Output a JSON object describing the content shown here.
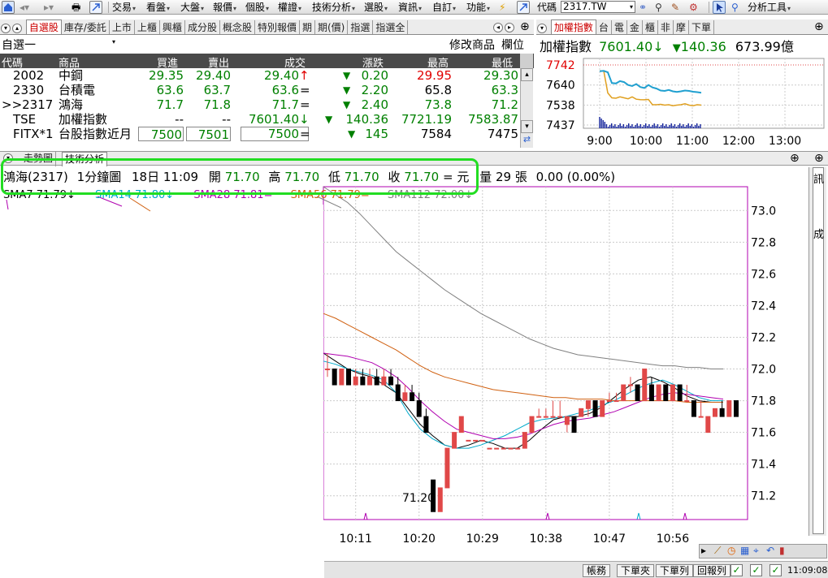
{
  "toolbar": {
    "menus": [
      "交易",
      "看盤",
      "大盤",
      "報價",
      "個股",
      "權證",
      "技術分析",
      "選股",
      "資訊",
      "自訂",
      "功能"
    ],
    "code_label": "代碼",
    "code_value": "2317.TW",
    "analysis_tool": "分析工具"
  },
  "left_tabs": [
    "自選股",
    "庫存/委託",
    "上市",
    "上櫃",
    "興櫃",
    "成分股",
    "概念股",
    "特別報價",
    "期",
    "期(價)",
    "指選",
    "指選全"
  ],
  "right_tabs": [
    "加權指數",
    "台",
    "電",
    "金",
    "櫃",
    "非",
    "摩",
    "下單"
  ],
  "watchlist": {
    "name": "自選一",
    "edit_label": "修改商品",
    "field_label": "欄位"
  },
  "quote_table": {
    "headers": [
      "代碼",
      "商品",
      "買進",
      "賣出",
      "成交",
      "漲跌",
      "最高",
      "最低"
    ],
    "rows": [
      {
        "code": "2002",
        "name": "中鋼",
        "bid": "29.35",
        "ask": "29.40",
        "last": "29.40",
        "last_mark": "↑",
        "chg_mark": "▼",
        "chg": "0.20",
        "high": "29.95",
        "low": "29.30"
      },
      {
        "code": "2330",
        "name": "台積電",
        "bid": "63.6",
        "ask": "63.7",
        "last": "63.6",
        "last_mark": "=",
        "chg_mark": "▼",
        "chg": "2.20",
        "high": "65.8",
        "low": "63.3"
      },
      {
        "code": ">>2317",
        "name": "鴻海",
        "bid": "71.7",
        "ask": "71.8",
        "last": "71.7",
        "last_mark": "=",
        "chg_mark": "▼",
        "chg": "2.40",
        "high": "73.8",
        "low": "71.2"
      },
      {
        "code": "TSE",
        "name": "加權指數",
        "bid": "--",
        "ask": "--",
        "last": "7601.40",
        "last_mark": "↓",
        "chg_mark": "▼",
        "chg": "140.36",
        "high": "7721.19",
        "low": "7583.87"
      },
      {
        "code": "FITX*1",
        "name": "台股指數近月",
        "bid": "7500",
        "ask": "7501",
        "last": "7500",
        "last_mark": "=",
        "chg_mark": "▼",
        "chg": "145",
        "high": "7584",
        "low": "7475"
      }
    ]
  },
  "index_panel": {
    "name": "加權指數",
    "value": "7601.40",
    "arrow": "↓",
    "chg_mark": "▼",
    "change": "140.36",
    "volume": "673.99億",
    "y_ticks": [
      "7742",
      "7640",
      "7538",
      "7437"
    ],
    "x_ticks": [
      "9:00",
      "10:00",
      "11:00",
      "12:00",
      "13:00"
    ]
  },
  "chart_tabs": [
    "走勢圖",
    "技術分析"
  ],
  "info": {
    "stock": "鴻海(2317)",
    "period": "1分鐘圖",
    "date": "18日",
    "time": "11:09",
    "open_label": "開",
    "open": "71.70",
    "high_label": "高",
    "high": "71.70",
    "low_label": "低",
    "low": "71.70",
    "close_label": "收",
    "close": "71.70",
    "eq": "= 元",
    "vol_label": "量",
    "volume": "29",
    "vol_unit": "張",
    "change": "0.00 (0.00%)"
  },
  "ma_line": {
    "sma7": "SMA7 71.79↓",
    "sma14": "SMA14 71.80↓",
    "sma28": "SMA28 71.81=",
    "sma56": "SMA56 71.79=",
    "sma112": "SMA112 72.00↓"
  },
  "chart_data": {
    "type": "candlestick",
    "y_ticks": [
      "73.0",
      "72.8",
      "72.6",
      "72.4",
      "72.2",
      "72.0",
      "71.8",
      "71.6",
      "71.4",
      "71.2"
    ],
    "x_ticks": [
      "10:11",
      "10:20",
      "10:29",
      "10:38",
      "10:47",
      "10:56"
    ],
    "low_annotation": "71.20",
    "candles": [
      [
        72.0,
        72.1,
        71.95,
        72.0
      ],
      [
        72.0,
        72.0,
        71.9,
        71.9
      ],
      [
        71.9,
        72.0,
        71.9,
        72.0
      ],
      [
        72.0,
        72.0,
        71.9,
        71.9
      ],
      [
        71.9,
        72.0,
        71.9,
        71.95
      ],
      [
        71.95,
        72.0,
        71.9,
        71.9
      ],
      [
        71.9,
        72.0,
        71.9,
        71.95
      ],
      [
        71.95,
        72.0,
        71.9,
        71.9
      ],
      [
        71.9,
        72.0,
        71.9,
        71.95
      ],
      [
        71.95,
        72.0,
        71.9,
        71.9
      ],
      [
        71.9,
        71.95,
        71.8,
        71.8
      ],
      [
        71.8,
        71.9,
        71.8,
        71.85
      ],
      [
        71.85,
        71.9,
        71.8,
        71.8
      ],
      [
        71.8,
        71.85,
        71.7,
        71.7
      ],
      [
        71.7,
        71.75,
        71.6,
        71.6
      ],
      [
        71.3,
        71.3,
        71.1,
        71.1
      ],
      [
        71.1,
        71.25,
        71.1,
        71.25
      ],
      [
        71.25,
        71.5,
        71.25,
        71.5
      ],
      [
        71.5,
        71.6,
        71.5,
        71.6
      ],
      [
        71.6,
        71.7,
        71.6,
        71.7
      ],
      [
        71.55,
        71.55,
        71.55,
        71.55
      ],
      [
        71.55,
        71.55,
        71.55,
        71.55
      ],
      [
        71.55,
        71.55,
        71.55,
        71.55
      ],
      [
        71.5,
        71.5,
        71.5,
        71.5
      ],
      [
        71.5,
        71.5,
        71.5,
        71.5
      ],
      [
        71.5,
        71.5,
        71.5,
        71.5
      ],
      [
        71.5,
        71.5,
        71.5,
        71.5
      ],
      [
        71.5,
        71.5,
        71.5,
        71.5
      ],
      [
        71.5,
        71.6,
        71.5,
        71.6
      ],
      [
        71.6,
        71.7,
        71.6,
        71.7
      ],
      [
        71.7,
        71.75,
        71.7,
        71.7
      ],
      [
        71.7,
        71.75,
        71.7,
        71.7
      ],
      [
        71.7,
        71.8,
        71.7,
        71.7
      ],
      [
        71.7,
        71.8,
        71.7,
        71.7
      ],
      [
        71.65,
        71.7,
        71.6,
        71.7
      ],
      [
        71.7,
        71.7,
        71.6,
        71.6
      ],
      [
        71.7,
        71.75,
        71.7,
        71.75
      ],
      [
        71.75,
        71.8,
        71.7,
        71.8
      ],
      [
        71.8,
        71.8,
        71.7,
        71.7
      ],
      [
        71.7,
        71.8,
        71.7,
        71.8
      ],
      [
        71.8,
        71.85,
        71.8,
        71.8
      ],
      [
        71.8,
        71.85,
        71.8,
        71.8
      ],
      [
        71.8,
        71.9,
        71.8,
        71.9
      ],
      [
        71.9,
        71.95,
        71.85,
        71.9
      ],
      [
        71.9,
        71.9,
        71.8,
        71.8
      ],
      [
        71.8,
        72.0,
        71.8,
        72.0
      ],
      [
        71.9,
        71.95,
        71.8,
        71.8
      ],
      [
        71.8,
        71.9,
        71.8,
        71.9
      ],
      [
        71.9,
        71.9,
        71.8,
        71.8
      ],
      [
        71.8,
        71.9,
        71.8,
        71.9
      ],
      [
        71.9,
        71.9,
        71.8,
        71.8
      ],
      [
        71.8,
        71.9,
        71.8,
        71.8
      ],
      [
        71.8,
        71.8,
        71.7,
        71.7
      ],
      [
        71.7,
        71.8,
        71.7,
        71.7
      ],
      [
        71.6,
        71.7,
        71.6,
        71.7
      ],
      [
        71.7,
        71.75,
        71.7,
        71.75
      ],
      [
        71.75,
        71.8,
        71.7,
        71.7
      ],
      [
        71.7,
        71.8,
        71.7,
        71.8
      ],
      [
        71.8,
        71.8,
        71.7,
        71.7
      ]
    ],
    "series": [
      {
        "name": "SMA7",
        "color": "#000000",
        "values": [
          72.1,
          72.05,
          72.0,
          71.97,
          71.95,
          71.9,
          71.85,
          71.75,
          71.65,
          71.58,
          71.52,
          71.5,
          71.52,
          71.55,
          71.53,
          71.5,
          71.5,
          71.55,
          71.62,
          71.68,
          71.7,
          71.7,
          71.72,
          71.76,
          71.82,
          71.88,
          71.93,
          71.95,
          71.92,
          71.88,
          71.83,
          71.8,
          71.79,
          71.79
        ]
      },
      {
        "name": "SMA14",
        "color": "#00aacc",
        "values": [
          72.05,
          72.03,
          72.0,
          71.98,
          71.96,
          71.93,
          71.85,
          71.72,
          71.62,
          71.56,
          71.52,
          71.5,
          71.5,
          71.52,
          71.55,
          71.58,
          71.62,
          71.66,
          71.68,
          71.69,
          71.7,
          71.72,
          71.74,
          71.77,
          71.8,
          71.84,
          71.88,
          71.91,
          71.93,
          71.9,
          71.86,
          71.82,
          71.8,
          71.8
        ]
      },
      {
        "name": "SMA28",
        "color": "#b000b0",
        "values": [
          72.1,
          72.09,
          72.08,
          72.06,
          72.04,
          72.0,
          71.95,
          71.88,
          71.8,
          71.73,
          71.67,
          71.62,
          71.6,
          71.58,
          71.56,
          71.56,
          71.57,
          71.59,
          71.62,
          71.65,
          71.67,
          71.68,
          71.69,
          71.71,
          71.73,
          71.76,
          71.79,
          71.82,
          71.84,
          71.85,
          71.84,
          71.83,
          71.82,
          71.81
        ]
      },
      {
        "name": "SMA56",
        "color": "#d06010",
        "values": [
          72.35,
          72.32,
          72.28,
          72.24,
          72.2,
          72.16,
          72.12,
          72.07,
          72.02,
          71.98,
          71.95,
          71.93,
          71.91,
          71.89,
          71.87,
          71.86,
          71.85,
          71.84,
          71.83,
          71.82,
          71.82,
          71.81,
          71.81,
          71.81,
          71.8,
          71.8,
          71.8,
          71.8,
          71.8,
          71.8,
          71.79,
          71.79,
          71.79,
          71.79
        ]
      },
      {
        "name": "SMA112",
        "color": "#808080",
        "values": [
          73.15,
          73.1,
          73.05,
          72.98,
          72.9,
          72.82,
          72.74,
          72.68,
          72.62,
          72.56,
          72.5,
          72.45,
          72.4,
          72.35,
          72.31,
          72.27,
          72.23,
          72.19,
          72.16,
          72.13,
          72.11,
          72.09,
          72.08,
          72.07,
          72.06,
          72.05,
          72.04,
          72.03,
          72.02,
          72.02,
          72.01,
          72.01,
          72.0,
          72.0
        ]
      }
    ]
  },
  "mini_chart": {
    "index_line": [
      7710,
      7712,
      7705,
      7650,
      7648,
      7660,
      7655,
      7640,
      7635,
      7645,
      7630,
      7625,
      7640,
      7628,
      7622,
      7612,
      7610,
      7615,
      7608,
      7605,
      7608,
      7612,
      7610,
      7606,
      7604,
      7601
    ],
    "fut_line": [
      7712,
      7712,
      7600,
      7575,
      7573,
      7580,
      7575,
      7570,
      7580,
      7568,
      7566,
      7565,
      7567,
      7540,
      7540,
      7542,
      7538,
      7540,
      7535,
      7538,
      7540,
      7545,
      7538,
      7535,
      7540,
      7538
    ]
  },
  "status": {
    "buttons": [
      "帳務",
      "下單夾",
      "下單列",
      "回報列"
    ],
    "checks": [
      "✓",
      "✓",
      "✓"
    ],
    "time": "11:09:08"
  }
}
